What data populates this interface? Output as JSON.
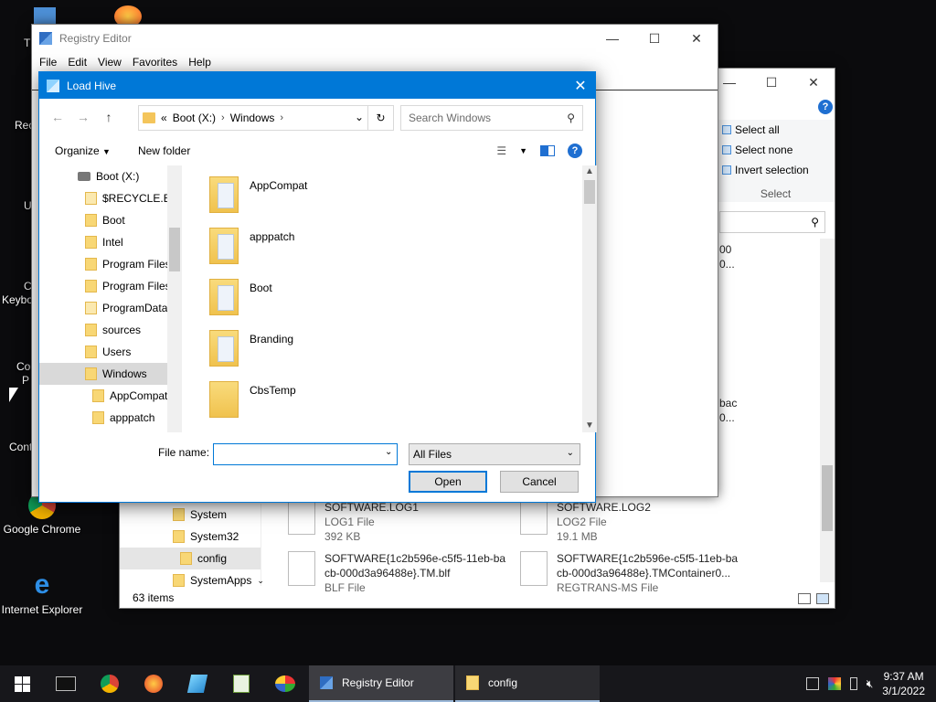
{
  "desktop": {
    "icons": [
      {
        "label": "Google Chrome"
      },
      {
        "label": "Internet Explorer"
      }
    ],
    "fragments": [
      "Rec",
      "U",
      "C",
      "Keybo",
      "Co",
      "P",
      "Cont",
      "Th"
    ]
  },
  "explorer": {
    "ribbon": {
      "select_all": "Select all",
      "select_none": "Select none",
      "invert_selection": "Invert selection",
      "group_label": "Select"
    },
    "tree": [
      {
        "label": "System"
      },
      {
        "label": "System32"
      },
      {
        "label": "config",
        "selected": true
      },
      {
        "label": "SystemApps"
      }
    ],
    "files": [
      {
        "name": "SOFTWARE.LOG1",
        "type": "LOG1 File",
        "size": "392 KB"
      },
      {
        "name": "SOFTWARE.LOG2",
        "type": "LOG2 File",
        "size": "19.1 MB"
      },
      {
        "name_line1": "SOFTWARE{1c2b596e-c5f5-11eb-ba",
        "name_line2": "cb-000d3a96488e}.TM.blf",
        "type": "BLF File"
      },
      {
        "name_line1": "SOFTWARE{1c2b596e-c5f5-11eb-ba",
        "name_line2": "cb-000d3a96488e}.TMContainer0...",
        "type": "REGTRANS-MS File"
      }
    ],
    "fragments": [
      "00",
      "0...",
      "bac",
      "0..."
    ],
    "status": "63 items"
  },
  "regedit": {
    "title": "Registry Editor",
    "menu": [
      "File",
      "Edit",
      "View",
      "Favorites",
      "Help"
    ]
  },
  "dialog": {
    "title": "Load Hive",
    "address": {
      "prefix": "«",
      "crumbs": [
        "Boot (X:)",
        "Windows"
      ]
    },
    "search_placeholder": "Search Windows",
    "organize": "Organize",
    "new_folder": "New folder",
    "nav_tree": [
      {
        "label": "Boot (X:)",
        "kind": "drive"
      },
      {
        "label": "$RECYCLE.BIN"
      },
      {
        "label": "Boot"
      },
      {
        "label": "Intel"
      },
      {
        "label": "Program Files"
      },
      {
        "label": "Program Files (x86)"
      },
      {
        "label": "ProgramData"
      },
      {
        "label": "sources"
      },
      {
        "label": "Users"
      },
      {
        "label": "Windows",
        "selected": true
      },
      {
        "label": "AppCompat",
        "child": true
      },
      {
        "label": "apppatch",
        "child": true
      }
    ],
    "folders": [
      {
        "label": "AppCompat"
      },
      {
        "label": "apppatch"
      },
      {
        "label": "Boot"
      },
      {
        "label": "Branding"
      },
      {
        "label": "CbsTemp"
      }
    ],
    "file_name_label": "File name:",
    "file_name_value": "",
    "file_type": "All Files",
    "open_label": "Open",
    "cancel_label": "Cancel"
  },
  "taskbar": {
    "tasks": [
      {
        "label": "Registry Editor",
        "active": true
      },
      {
        "label": "config",
        "active": false
      }
    ],
    "time": "9:37 AM",
    "date": "3/1/2022"
  },
  "colors": {
    "accent": "#0078d7",
    "folder": "#f8d775"
  }
}
